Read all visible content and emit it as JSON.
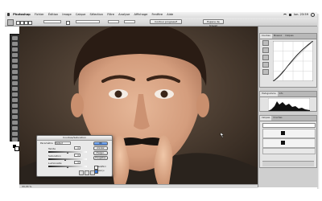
{
  "menubar": {
    "items": [
      "Photoshop",
      "Fichier",
      "Édition",
      "Image",
      "Calque",
      "Sélection",
      "Filtre",
      "Analyse",
      "Affichage",
      "Fenêtre",
      "Aide"
    ],
    "clock": "lun. 23:59"
  },
  "options": {
    "field_value": "",
    "button_label": "Contour progressif",
    "workspace": "Espace de travail"
  },
  "status": {
    "zoom": "33,33 %"
  },
  "panels": {
    "curves": {
      "tabs": [
        "Courbes",
        "Niveaux",
        "Calques"
      ]
    },
    "histogram": {
      "tabs": [
        "Histogramme",
        "Info"
      ]
    },
    "channels": {
      "tabs": [
        "Calques",
        "Couches"
      ]
    }
  },
  "dialog": {
    "title": "Courbes/Saturation",
    "preset_label": "Paramètre",
    "preset_value": "Défaut",
    "slider1_label": "Teinte",
    "slider1_value": "0",
    "slider2_label": "Saturation",
    "slider2_value": "0",
    "slider3_label": "Luminosité",
    "slider3_value": "0",
    "ok_label": "OK",
    "cancel_label": "Annuler",
    "load_label": "Charger...",
    "save_label": "Enregistrer",
    "colorize_label": "Redéfinir",
    "preview_label": "Aperçu",
    "levels": {
      "teinte": 0.5,
      "saturation": 0.45,
      "luminosite": 0.5
    }
  },
  "colors": {
    "accent": "#3c78d8",
    "face": "#d9a788",
    "background": "#4a3b30"
  }
}
